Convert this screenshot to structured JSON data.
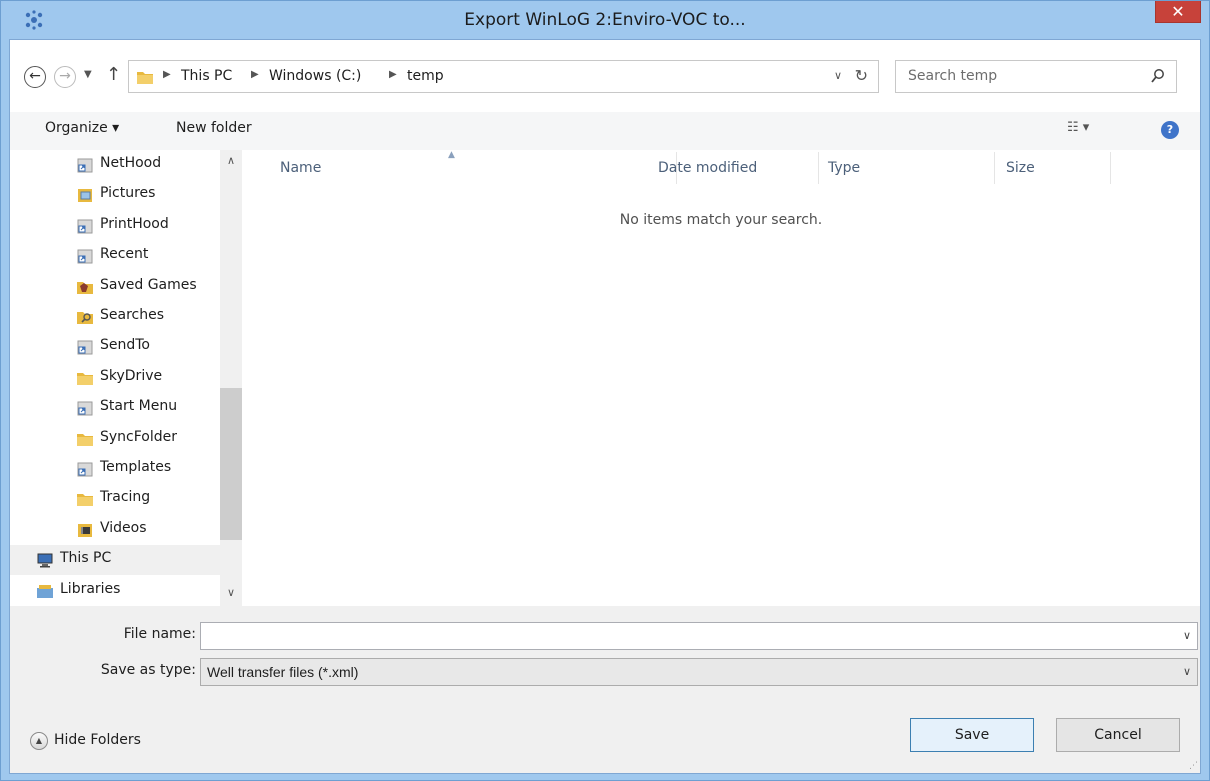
{
  "window": {
    "title": "Export WinLoG 2:Enviro-VOC to...",
    "close_label": "✕"
  },
  "address": {
    "crumbs": [
      "This PC",
      "Windows (C:)",
      "temp"
    ],
    "search_placeholder": "Search temp"
  },
  "toolbar": {
    "organize_label": "Organize ▾",
    "new_folder_label": "New folder"
  },
  "nav": {
    "items": [
      {
        "label": "NetHood",
        "icon": "shortcut-folder-icon"
      },
      {
        "label": "Pictures",
        "icon": "pictures-folder-icon"
      },
      {
        "label": "PrintHood",
        "icon": "shortcut-folder-icon"
      },
      {
        "label": "Recent",
        "icon": "shortcut-folder-icon"
      },
      {
        "label": "Saved Games",
        "icon": "saved-games-icon"
      },
      {
        "label": "Searches",
        "icon": "searches-folder-icon"
      },
      {
        "label": "SendTo",
        "icon": "shortcut-folder-icon"
      },
      {
        "label": "SkyDrive",
        "icon": "folder-icon"
      },
      {
        "label": "Start Menu",
        "icon": "shortcut-folder-icon"
      },
      {
        "label": "SyncFolder",
        "icon": "folder-icon"
      },
      {
        "label": "Templates",
        "icon": "shortcut-folder-icon"
      },
      {
        "label": "Tracing",
        "icon": "folder-icon"
      },
      {
        "label": "Videos",
        "icon": "videos-folder-icon"
      },
      {
        "label": "This PC",
        "icon": "computer-icon"
      },
      {
        "label": "Libraries",
        "icon": "libraries-icon"
      }
    ]
  },
  "filelist": {
    "columns": [
      "Name",
      "Date modified",
      "Type",
      "Size"
    ],
    "empty_message": "No items match your search."
  },
  "form": {
    "file_name_label": "File name:",
    "file_name_value": "",
    "save_type_label": "Save as type:",
    "save_type_value": "Well transfer files (*.xml)"
  },
  "footer": {
    "hide_folders_label": "Hide Folders",
    "save_label": "Save",
    "cancel_label": "Cancel"
  },
  "colors": {
    "frame": "#9fc8ee",
    "close": "#c7423a",
    "folder": "#e8b93f"
  }
}
